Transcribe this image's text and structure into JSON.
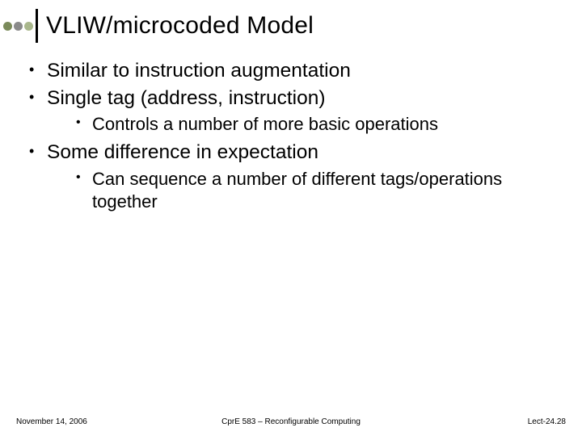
{
  "title": "VLIW/microcoded Model",
  "dots": [
    "#7a8a5a",
    "#8a8a8a",
    "#a9b78c"
  ],
  "bullets": {
    "b1": "Similar to instruction augmentation",
    "b2": "Single tag (address, instruction)",
    "b2_1": "Controls a number of more basic operations",
    "b3": "Some difference in expectation",
    "b3_1": "Can sequence a number of different tags/operations together"
  },
  "footer": {
    "left": "November 14, 2006",
    "center": "CprE 583 – Reconfigurable Computing",
    "right": "Lect-24.28"
  }
}
